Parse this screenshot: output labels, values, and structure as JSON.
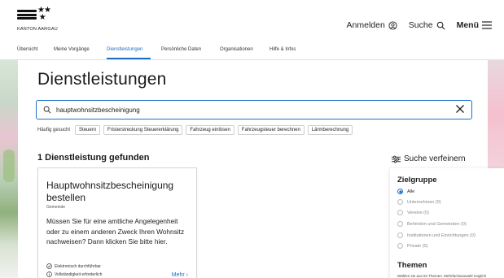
{
  "header": {
    "logo_text": "KANTON AARGAU",
    "login_label": "Anmelden",
    "search_label": "Suche",
    "menu_label": "Menü"
  },
  "nav": {
    "tabs": [
      {
        "label": "Übersicht"
      },
      {
        "label": "Meine Vorgänge"
      },
      {
        "label": "Dienstleistungen",
        "active": true
      },
      {
        "label": "Persönliche Daten"
      },
      {
        "label": "Organisationen"
      },
      {
        "label": "Hilfe & Infos"
      }
    ]
  },
  "main": {
    "title": "Dienstleistungen",
    "search_value": "hauptwohnsitzbescheinigung",
    "frequent_label": "Häufig gesucht",
    "chips": [
      "Steuern",
      "Fristerstreckung Steuererklärung",
      "Fahrzeug einlösen",
      "Fahrzeugsteuer berechnen",
      "Lärmberechnung"
    ],
    "results_heading": "1 Dienstleistung gefunden"
  },
  "card": {
    "title": "Hauptwohnsitzbescheinigung bestellen",
    "org": "Gemeinde",
    "description": "Müssen Sie für eine amtliche Angelegenheit oder zu einem anderen Zweck Ihren Wohnsitz nachweisen? Dann klicken Sie bitte hier.",
    "meta1": "Elektronisch durchführbar",
    "meta2": "Vollständigkeit erforderlich",
    "more_label": "Mehr"
  },
  "filters": {
    "refine_label": "Suche verfeinern",
    "zielgruppe_heading": "Zielgruppe",
    "options": [
      {
        "label": "Alle",
        "checked": true
      },
      {
        "label": "Unternehmen (0)",
        "checked": false
      },
      {
        "label": "Vereine (0)",
        "checked": false
      },
      {
        "label": "Behörden und Gemeinden (0)",
        "checked": false
      },
      {
        "label": "Institutionen und Einrichtungen (0)",
        "checked": false
      },
      {
        "label": "Private (0)",
        "checked": false
      }
    ],
    "themen_heading": "Themen",
    "themen_sub": "Wählen sie aus 62 Themen. Mehrfachauswahl möglich"
  },
  "colors": {
    "accent": "#1d6fc6"
  },
  "icons": [
    "login-icon",
    "search-icon",
    "menu-icon",
    "clear-icon",
    "filter-icon",
    "check-circle-icon",
    "info-circle-icon"
  ]
}
